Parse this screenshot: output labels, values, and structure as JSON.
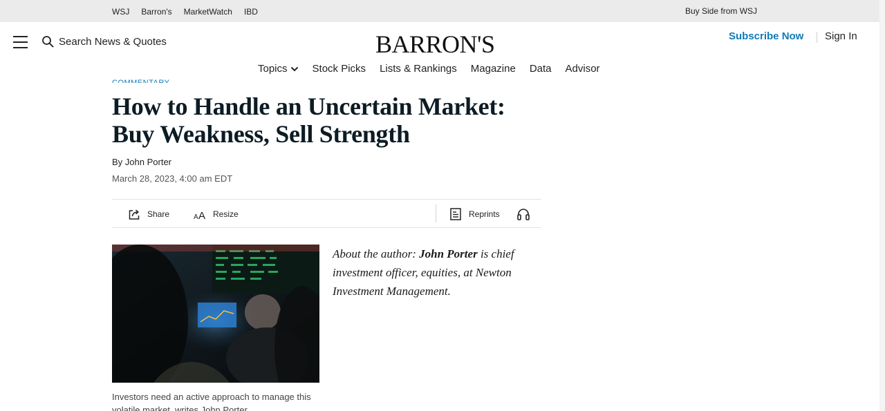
{
  "topbar": {
    "links": [
      "WSJ",
      "Barron's",
      "MarketWatch",
      "IBD"
    ],
    "buyside": "Buy Side from WSJ"
  },
  "header": {
    "menu_icon": "hamburger-menu-icon",
    "search_icon": "magnifier-icon",
    "search_label": "Search News & Quotes",
    "logo": "BARRON'S",
    "subscribe": "Subscribe Now",
    "signin": "Sign In",
    "accent_color": "#0f7bb8"
  },
  "nav": {
    "items": [
      "Topics",
      "Stock Picks",
      "Lists & Rankings",
      "Magazine",
      "Data",
      "Advisor"
    ],
    "topics_icon": "chevron-down-icon"
  },
  "article": {
    "kicker": "COMMENTARY",
    "headline_line1": "How to Handle an Uncertain Market:",
    "headline_line2": "Buy Weakness, Sell Strength",
    "by_prefix": "By",
    "author": "John Porter",
    "date": "March 28, 2023, 4:00 am EDT",
    "headline_color": "#0d1c24"
  },
  "toolbar": {
    "share": "Share",
    "share_icon": "share-icon",
    "resize": "Resize",
    "resize_icon": "text-resize-icon",
    "reprints": "Reprints",
    "reprints_icon": "document-icon",
    "listen_icon": "headphones-icon"
  },
  "media": {
    "caption": "Investors need an active approach to manage this volatile market, writes John Porter."
  },
  "about": {
    "prefix": "About the author: ",
    "name": "John Porter",
    "suffix": " is chief investment officer, equities, at Newton Investment Management."
  }
}
